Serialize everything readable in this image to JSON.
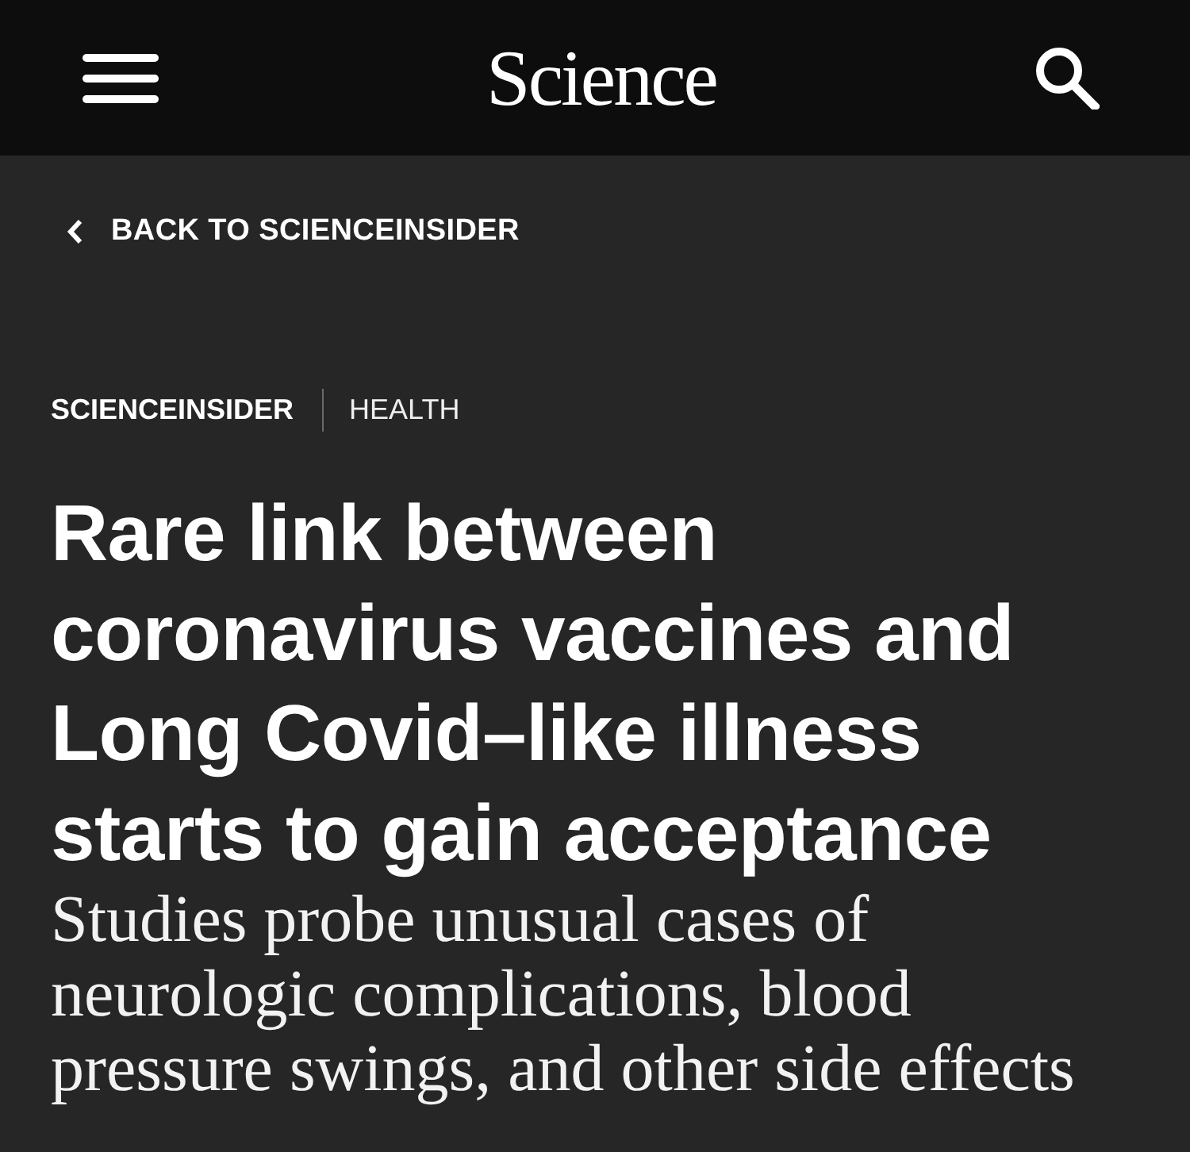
{
  "header": {
    "logo": "Science"
  },
  "back_link": {
    "label": "BACK TO SCIENCEINSIDER"
  },
  "breadcrumb": [
    {
      "label": "SCIENCEINSIDER",
      "kind": "section"
    },
    {
      "label": "HEALTH",
      "kind": "topic"
    }
  ],
  "article": {
    "headline": "Rare link between coronavirus vaccines and Long Covid–like illness starts to gain acceptance",
    "standfirst": "Studies probe unusual cases of neurologic complications, blood pressure swings, and other side effects"
  }
}
